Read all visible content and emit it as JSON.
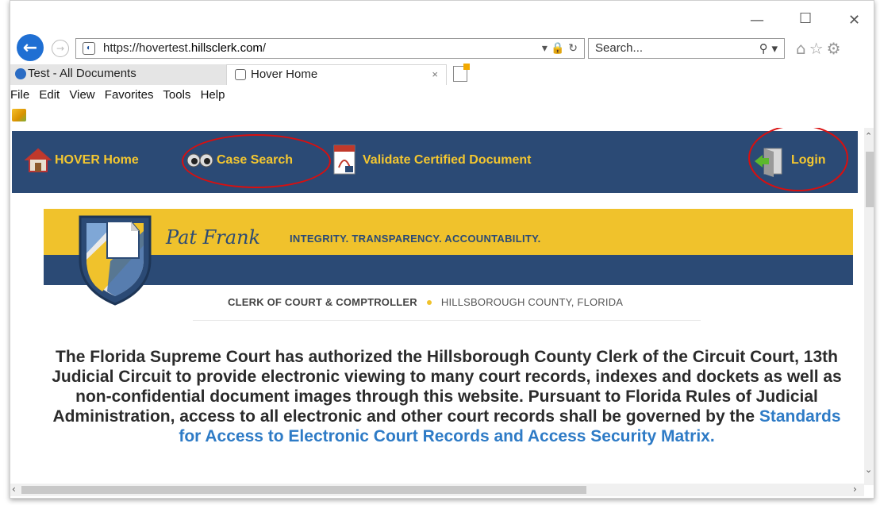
{
  "window": {
    "minimize": "—",
    "maximize": "☐",
    "close": "✕"
  },
  "browser": {
    "back_glyph": "←",
    "forward_glyph": "→",
    "url_prefix": "https://hovertest.",
    "url_domain": "hillsclerk.com",
    "url_suffix": "/",
    "address_icons": "▾ 🔒 ↻",
    "search_placeholder": "Search...",
    "search_icon_glyph": "⚲ ▾",
    "toolbar_icons": "⌂☆⚙",
    "tabs": [
      {
        "label": "Test - All Documents",
        "active": false
      },
      {
        "label": "Hover Home",
        "active": true,
        "close": "×"
      }
    ],
    "menu": [
      "File",
      "Edit",
      "View",
      "Favorites",
      "Tools",
      "Help"
    ]
  },
  "nav": {
    "items": [
      {
        "label": "HOVER Home",
        "icon": "house-icon"
      },
      {
        "label": "Case Search",
        "icon": "eyes-icon",
        "circled": true
      },
      {
        "label": "Validate Certified Document",
        "icon": "pdf-document-icon"
      },
      {
        "label": "Login",
        "icon": "login-door-icon",
        "circled": true
      }
    ]
  },
  "banner": {
    "name": "Pat Frank",
    "motto": "INTEGRITY. TRANSPARENCY. ACCOUNTABILITY.",
    "clerk_title": "CLERK OF COURT & COMPTROLLER",
    "county": "HILLSBOROUGH COUNTY, FLORIDA"
  },
  "intro": {
    "text": "The Florida Supreme Court has authorized the Hillsborough County Clerk of the Circuit Court, 13th Judicial Circuit to provide electronic viewing to many court records, indexes and dockets as well as non-confidential document images through this website. Pursuant to Florida Rules of Judicial Administration, access to all electronic and other court records shall be governed by the ",
    "link_text": "Standards for Access to Electronic Court Records and Access Security Matrix."
  },
  "colors": {
    "nav_bg": "#2b4a75",
    "nav_text": "#f4c730",
    "banner_yellow": "#f0c22c",
    "link_blue": "#2e7bc6",
    "annotation_red": "#d90f0f"
  }
}
